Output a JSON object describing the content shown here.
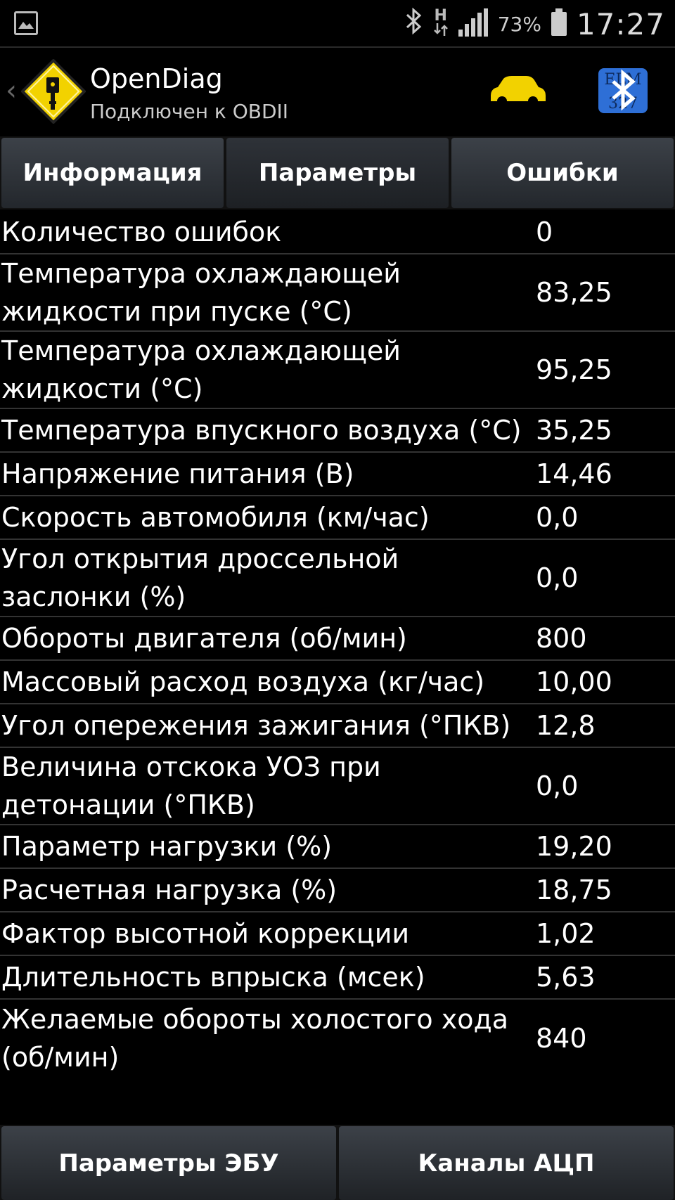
{
  "status_bar": {
    "battery_percent": "73%",
    "time": "17:27",
    "network": "H",
    "icons": [
      "gallery-icon",
      "bluetooth-icon",
      "signal-icon",
      "battery-icon"
    ]
  },
  "action_bar": {
    "title": "OpenDiag",
    "subtitle": "Подключен к OBDII",
    "elm_label": "ELM 327",
    "colors": {
      "accent": "#33b5e5",
      "car": "#f2d200",
      "elm": "#2e6fd6"
    }
  },
  "tabs": [
    {
      "label": "Информация"
    },
    {
      "label": "Параметры"
    },
    {
      "label": "Ошибки"
    }
  ],
  "parameters": [
    {
      "label": "Количество ошибок",
      "value": "0"
    },
    {
      "label": "Температура охлаждающей жидкости при пуске (°C)",
      "value": "83,25"
    },
    {
      "label": "Температура охлаждающей жидкости (°C)",
      "value": "95,25"
    },
    {
      "label": "Температура впускного воздуха (°C)",
      "value": "35,25"
    },
    {
      "label": "Напряжение питания (В)",
      "value": "14,46"
    },
    {
      "label": "Скорость автомобиля (км/час)",
      "value": "0,0"
    },
    {
      "label": "Угол открытия дроссельной заслонки (%)",
      "value": "0,0"
    },
    {
      "label": "Обороты двигателя (об/мин)",
      "value": "800"
    },
    {
      "label": "Массовый расход воздуха (кг/час)",
      "value": "10,00"
    },
    {
      "label": "Угол опережения зажигания (°ПКВ)",
      "value": "12,8"
    },
    {
      "label": "Величина отскока УОЗ при детонации (°ПКВ)",
      "value": "0,0"
    },
    {
      "label": "Параметр нагрузки (%)",
      "value": "19,20"
    },
    {
      "label": "Расчетная нагрузка (%)",
      "value": "18,75"
    },
    {
      "label": "Фактор высотной коррекции",
      "value": "1,02"
    },
    {
      "label": "Длительность впрыска (мсек)",
      "value": "5,63"
    },
    {
      "label": "Желаемые обороты холостого хода (об/мин)",
      "value": "840"
    }
  ],
  "bottom_buttons": [
    {
      "label": "Параметры ЭБУ"
    },
    {
      "label": "Каналы АЦП"
    }
  ]
}
